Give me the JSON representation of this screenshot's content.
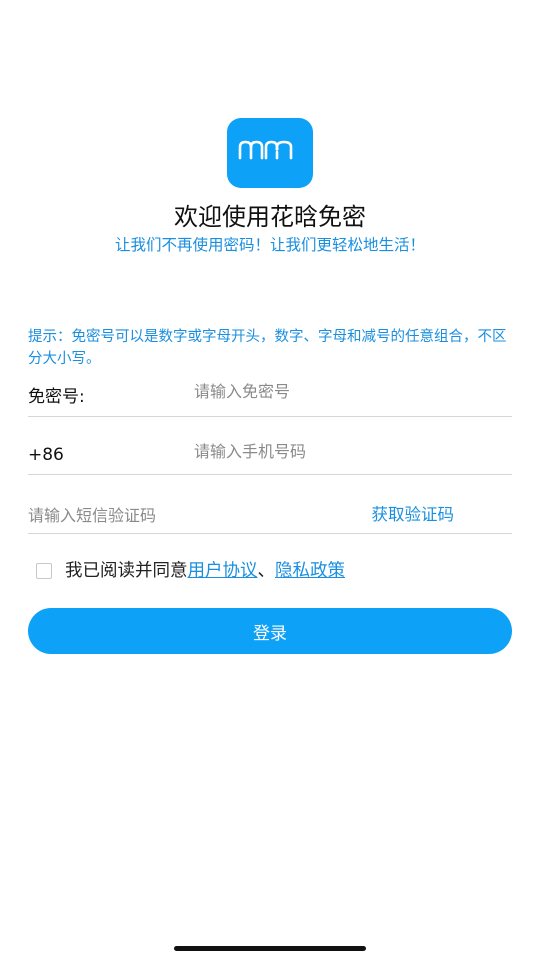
{
  "app": {
    "icon": "mm-logo-icon",
    "brand_color": "#0da2f7",
    "link_color": "#1a8fe0"
  },
  "header": {
    "title": "欢迎使用花晗免密",
    "subtitle": "让我们不再使用密码！让我们更轻松地生活！"
  },
  "hint": "提示：免密号可以是数字或字母开头，数字、字母和减号的任意组合，不区分大小写。",
  "form": {
    "username": {
      "label": "免密号:",
      "value": "",
      "placeholder": "请输入免密号"
    },
    "phone": {
      "label": "+86",
      "value": "",
      "placeholder": "请输入手机号码"
    },
    "code": {
      "value": "",
      "placeholder": "请输入短信验证码",
      "get_code_label": "获取验证码"
    }
  },
  "agreement": {
    "checked": false,
    "prefix": "我已阅读并同意",
    "user_agreement": "用户协议",
    "separator": "、",
    "privacy_policy": "隐私政策"
  },
  "login_button": "登录"
}
